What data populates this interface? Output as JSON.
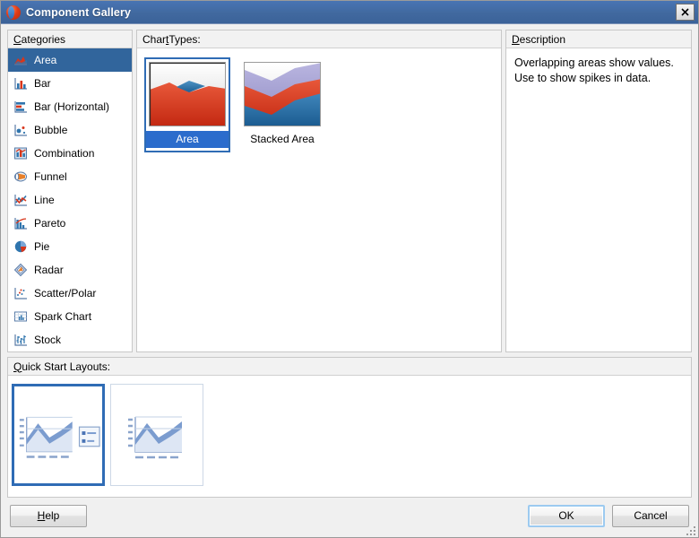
{
  "window": {
    "title": "Component Gallery",
    "icon": "oracle-logo-icon",
    "close_label": "✕"
  },
  "categories": {
    "header": "Categories",
    "header_mnemonic": "C",
    "selected_index": 0,
    "items": [
      {
        "label": "Area",
        "icon": "area-chart-icon"
      },
      {
        "label": "Bar",
        "icon": "bar-chart-icon"
      },
      {
        "label": "Bar (Horizontal)",
        "icon": "horizontal-bar-chart-icon"
      },
      {
        "label": "Bubble",
        "icon": "bubble-chart-icon"
      },
      {
        "label": "Combination",
        "icon": "combination-chart-icon"
      },
      {
        "label": "Funnel",
        "icon": "funnel-chart-icon"
      },
      {
        "label": "Line",
        "icon": "line-chart-icon"
      },
      {
        "label": "Pareto",
        "icon": "pareto-chart-icon"
      },
      {
        "label": "Pie",
        "icon": "pie-chart-icon"
      },
      {
        "label": "Radar",
        "icon": "radar-chart-icon"
      },
      {
        "label": "Scatter/Polar",
        "icon": "scatter-chart-icon"
      },
      {
        "label": "Spark Chart",
        "icon": "spark-chart-icon"
      },
      {
        "label": "Stock",
        "icon": "stock-chart-icon"
      }
    ]
  },
  "chart_types": {
    "header": "Chart Types:",
    "selected_index": 0,
    "items": [
      {
        "label": "Area",
        "thumb": "area-thumbnail"
      },
      {
        "label": "Stacked Area",
        "thumb": "stacked-area-thumbnail"
      }
    ]
  },
  "description": {
    "header": "Description",
    "text": "Overlapping areas show values. Use to show spikes in data."
  },
  "quick_start": {
    "header": "Quick Start Layouts:",
    "selected_index": 0,
    "items": [
      {
        "name": "area-with-legend-layout"
      },
      {
        "name": "area-plain-layout"
      }
    ]
  },
  "buttons": {
    "help": "Help",
    "ok": "OK",
    "cancel": "Cancel"
  },
  "colors": {
    "titlebar": "#41699f",
    "selection": "#31659c",
    "caption_selection": "#2b6ccc",
    "focus_border": "#2f6cb5",
    "series_red": "#d8361b",
    "series_blue": "#2f74ad",
    "series_purple": "#9a9ad0"
  }
}
